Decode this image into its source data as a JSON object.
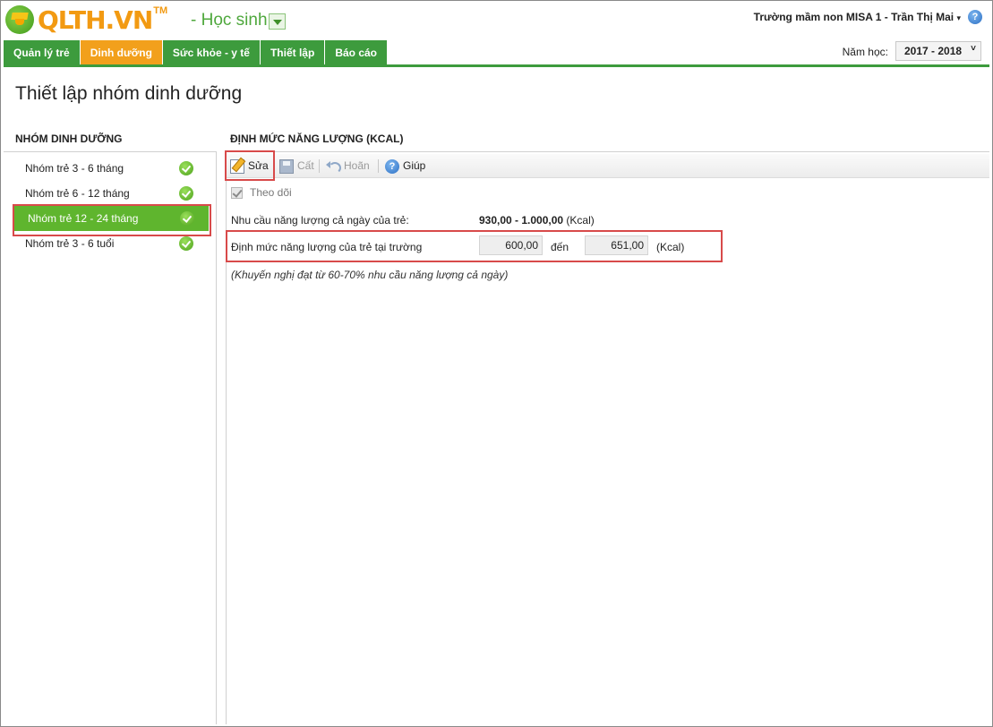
{
  "header": {
    "logo_text": "QLTH.VN",
    "logo_tm": "TM",
    "role": "- Học sinh",
    "school_user": "Trường mầm non MISA 1 - Trần Thị Mai",
    "school_caret": "▾",
    "help_glyph": "?"
  },
  "nav": {
    "tabs": [
      {
        "label": "Quản lý trẻ",
        "active": false
      },
      {
        "label": "Dinh dưỡng",
        "active": true
      },
      {
        "label": "Sức khỏe - y tế",
        "active": false
      },
      {
        "label": "Thiết lập",
        "active": false
      },
      {
        "label": "Báo cáo",
        "active": false
      }
    ],
    "year_label": "Năm học:",
    "year_value": "2017 - 2018",
    "year_chev": "˅"
  },
  "page": {
    "title": "Thiết lập nhóm dinh dưỡng"
  },
  "groups": {
    "heading": "NHÓM DINH DƯỠNG",
    "items": [
      {
        "label": "Nhóm trẻ 3 - 6 tháng",
        "selected": false
      },
      {
        "label": "Nhóm trẻ 6 - 12 tháng",
        "selected": false
      },
      {
        "label": "Nhóm trẻ 12 - 24 tháng",
        "selected": true
      },
      {
        "label": "Nhóm trẻ 3 - 6 tuổi",
        "selected": false
      }
    ]
  },
  "energy": {
    "heading": "ĐỊNH MỨC NĂNG LƯỢNG (KCAL)",
    "toolbar": {
      "edit": "Sửa",
      "save": "Cất",
      "undo": "Hoãn",
      "help": "Giúp",
      "help_glyph": "?"
    },
    "follow_label": "Theo dõi",
    "follow_checked": true,
    "need_label": "Nhu cầu năng lượng cả ngày của trẻ:",
    "need_range": "930,00 - 1.000,00",
    "need_unit": "(Kcal)",
    "norm_label": "Định mức năng lượng của trẻ tại trường",
    "norm_from": "600,00",
    "norm_to_label": "đến",
    "norm_to": "651,00",
    "norm_unit": "(Kcal)",
    "hint": "(Khuyến nghị đạt từ 60-70% nhu cầu năng lượng cả ngày)"
  },
  "colors": {
    "brand_green": "#3d9b3d",
    "active_tab": "#f2a01c",
    "selected_row": "#5fb52e",
    "highlight_box": "#d84a4a"
  }
}
